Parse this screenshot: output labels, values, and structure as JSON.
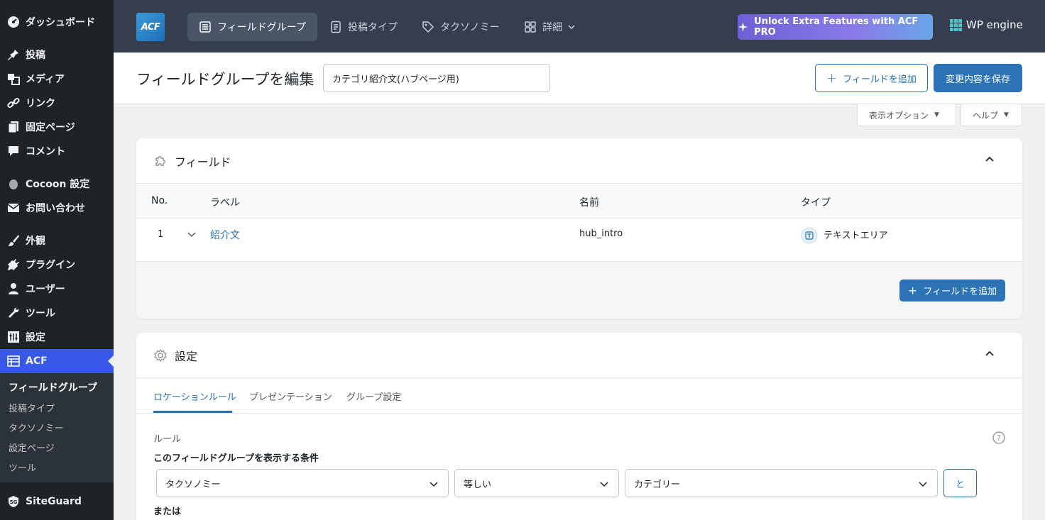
{
  "sidebar": {
    "items": [
      {
        "label": "ダッシュボード",
        "icon": "dashboard-icon"
      },
      {
        "label": "投稿",
        "icon": "pin-icon"
      },
      {
        "label": "メディア",
        "icon": "media-icon"
      },
      {
        "label": "リンク",
        "icon": "link-icon"
      },
      {
        "label": "固定ページ",
        "icon": "page-icon"
      },
      {
        "label": "コメント",
        "icon": "comment-icon"
      },
      {
        "label": "Cocoon 設定",
        "icon": "cocoon-icon"
      },
      {
        "label": "お問い合わせ",
        "icon": "mail-icon"
      },
      {
        "label": "外観",
        "icon": "brush-icon"
      },
      {
        "label": "プラグイン",
        "icon": "plugin-icon"
      },
      {
        "label": "ユーザー",
        "icon": "user-icon"
      },
      {
        "label": "ツール",
        "icon": "wrench-icon"
      },
      {
        "label": "設定",
        "icon": "settings-icon"
      },
      {
        "label": "ACF",
        "icon": "acf-icon"
      }
    ],
    "submenu": [
      "フィールドグループ",
      "投稿タイプ",
      "タクソノミー",
      "設定ページ",
      "ツール"
    ],
    "bottom": "SiteGuard"
  },
  "topnav": {
    "logo": "ACF",
    "tabs": [
      "フィールドグループ",
      "投稿タイプ",
      "タクソノミー",
      "詳細"
    ],
    "pro_label": "Unlock Extra Features with ACF PRO",
    "wpengine": "WP engine"
  },
  "header": {
    "title": "フィールドグループを編集",
    "group_name": "カテゴリ紹介文(ハブページ用)",
    "add_field": "フィールドを追加",
    "save": "変更内容を保存"
  },
  "options": {
    "display": "表示オプション",
    "help": "ヘルプ"
  },
  "fields_panel": {
    "title": "フィールド",
    "columns": [
      "No.",
      "ラベル",
      "名前",
      "タイプ"
    ],
    "rows": [
      {
        "no": "1",
        "label": "紹介文",
        "name": "hub_intro",
        "type": "テキストエリア"
      }
    ],
    "add_field": "フィールドを追加"
  },
  "settings_panel": {
    "title": "設定",
    "tabs": [
      "ロケーションルール",
      "プレゼンテーション",
      "グループ設定"
    ],
    "rules_label": "ルール",
    "condition_label": "このフィールドグループを表示する条件",
    "param": "タクソノミー",
    "operator": "等しい",
    "value": "カテゴリー",
    "and_label": "と",
    "or_label": "または"
  },
  "colors": {
    "sidebar_bg": "#1d2327",
    "topnav_bg": "#343e4f",
    "accent": "#2271b1",
    "active_menu": "#3858e9"
  }
}
